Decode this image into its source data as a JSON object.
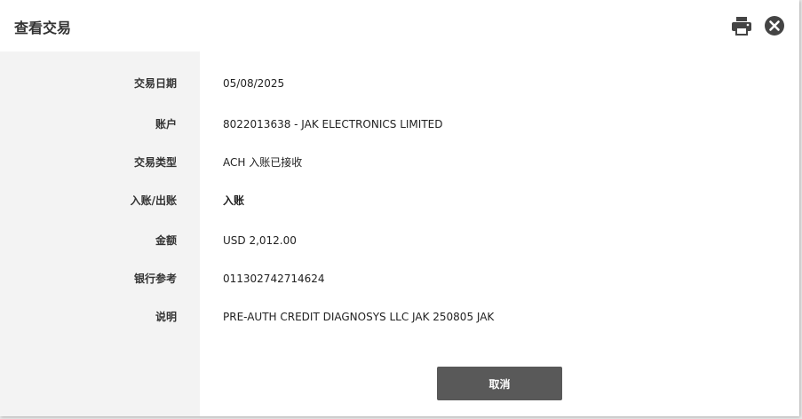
{
  "dialog": {
    "title": "查看交易",
    "print_icon": "printer-icon",
    "close_icon": "close-circle-icon"
  },
  "fields": [
    {
      "label": "交易日期",
      "value": "05/08/2025"
    },
    {
      "label": "账户",
      "value": "8022013638 - JAK ELECTRONICS LIMITED"
    },
    {
      "label": "交易类型",
      "value": "ACH 入账已接收"
    },
    {
      "label": "入账/出账",
      "value": "入账"
    },
    {
      "label": "金额",
      "value": "USD 2,012.00"
    },
    {
      "label": "银行参考",
      "value": "011302742714624"
    },
    {
      "label": "说明",
      "value": "PRE-AUTH CREDIT DIAGNOSYS LLC JAK 250805 JAK"
    }
  ],
  "buttons": {
    "cancel_label": "取消"
  },
  "colors": {
    "label_column_bg": "#f3f3f3",
    "button_bg": "#595959",
    "icon_color": "#444444"
  }
}
